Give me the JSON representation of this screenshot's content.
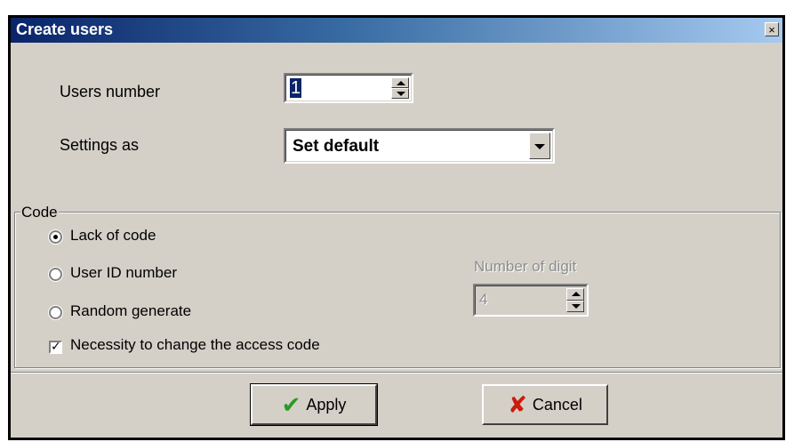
{
  "window": {
    "title": "Create users",
    "close_glyph": "×"
  },
  "users_number": {
    "label": "Users number",
    "value": "1"
  },
  "settings_as": {
    "label": "Settings as",
    "selected": "Set default"
  },
  "code_group": {
    "label": "Code",
    "options": [
      {
        "label": "Lack of code",
        "checked": true
      },
      {
        "label": "User ID number",
        "checked": false
      },
      {
        "label": "Random generate",
        "checked": false
      }
    ],
    "necessity_checkbox": {
      "label": "Necessity to change the access code",
      "checked": true
    },
    "number_of_digit": {
      "label": "Number of digit",
      "value": "4",
      "enabled": false
    }
  },
  "buttons": {
    "apply_label": "Apply",
    "cancel_label": "Cancel"
  },
  "icons": {
    "apply": "check-icon",
    "cancel": "x-icon"
  },
  "colors": {
    "titlebar_start": "#0a246a",
    "titlebar_end": "#a6caf0",
    "check_green": "#2a9a24",
    "cancel_red": "#cc1a0c",
    "window_bg": "#d4d0c8"
  }
}
